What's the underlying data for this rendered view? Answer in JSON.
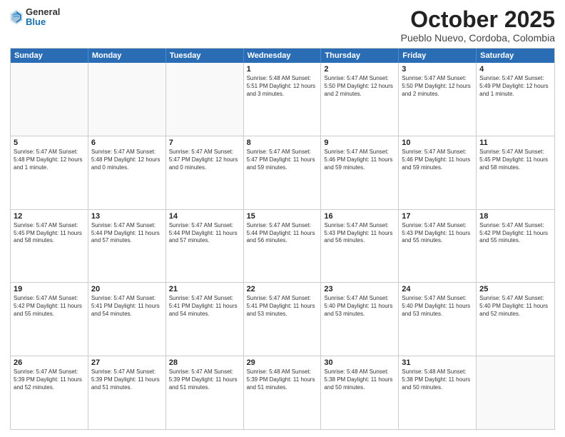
{
  "logo": {
    "general": "General",
    "blue": "Blue"
  },
  "title": "October 2025",
  "subtitle": "Pueblo Nuevo, Cordoba, Colombia",
  "days": [
    "Sunday",
    "Monday",
    "Tuesday",
    "Wednesday",
    "Thursday",
    "Friday",
    "Saturday"
  ],
  "weeks": [
    [
      {
        "day": "",
        "data": ""
      },
      {
        "day": "",
        "data": ""
      },
      {
        "day": "",
        "data": ""
      },
      {
        "day": "1",
        "data": "Sunrise: 5:48 AM\nSunset: 5:51 PM\nDaylight: 12 hours and 3 minutes."
      },
      {
        "day": "2",
        "data": "Sunrise: 5:47 AM\nSunset: 5:50 PM\nDaylight: 12 hours and 2 minutes."
      },
      {
        "day": "3",
        "data": "Sunrise: 5:47 AM\nSunset: 5:50 PM\nDaylight: 12 hours and 2 minutes."
      },
      {
        "day": "4",
        "data": "Sunrise: 5:47 AM\nSunset: 5:49 PM\nDaylight: 12 hours and 1 minute."
      }
    ],
    [
      {
        "day": "5",
        "data": "Sunrise: 5:47 AM\nSunset: 5:48 PM\nDaylight: 12 hours and 1 minute."
      },
      {
        "day": "6",
        "data": "Sunrise: 5:47 AM\nSunset: 5:48 PM\nDaylight: 12 hours and 0 minutes."
      },
      {
        "day": "7",
        "data": "Sunrise: 5:47 AM\nSunset: 5:47 PM\nDaylight: 12 hours and 0 minutes."
      },
      {
        "day": "8",
        "data": "Sunrise: 5:47 AM\nSunset: 5:47 PM\nDaylight: 11 hours and 59 minutes."
      },
      {
        "day": "9",
        "data": "Sunrise: 5:47 AM\nSunset: 5:46 PM\nDaylight: 11 hours and 59 minutes."
      },
      {
        "day": "10",
        "data": "Sunrise: 5:47 AM\nSunset: 5:46 PM\nDaylight: 11 hours and 59 minutes."
      },
      {
        "day": "11",
        "data": "Sunrise: 5:47 AM\nSunset: 5:45 PM\nDaylight: 11 hours and 58 minutes."
      }
    ],
    [
      {
        "day": "12",
        "data": "Sunrise: 5:47 AM\nSunset: 5:45 PM\nDaylight: 11 hours and 58 minutes."
      },
      {
        "day": "13",
        "data": "Sunrise: 5:47 AM\nSunset: 5:44 PM\nDaylight: 11 hours and 57 minutes."
      },
      {
        "day": "14",
        "data": "Sunrise: 5:47 AM\nSunset: 5:44 PM\nDaylight: 11 hours and 57 minutes."
      },
      {
        "day": "15",
        "data": "Sunrise: 5:47 AM\nSunset: 5:44 PM\nDaylight: 11 hours and 56 minutes."
      },
      {
        "day": "16",
        "data": "Sunrise: 5:47 AM\nSunset: 5:43 PM\nDaylight: 11 hours and 56 minutes."
      },
      {
        "day": "17",
        "data": "Sunrise: 5:47 AM\nSunset: 5:43 PM\nDaylight: 11 hours and 55 minutes."
      },
      {
        "day": "18",
        "data": "Sunrise: 5:47 AM\nSunset: 5:42 PM\nDaylight: 11 hours and 55 minutes."
      }
    ],
    [
      {
        "day": "19",
        "data": "Sunrise: 5:47 AM\nSunset: 5:42 PM\nDaylight: 11 hours and 55 minutes."
      },
      {
        "day": "20",
        "data": "Sunrise: 5:47 AM\nSunset: 5:41 PM\nDaylight: 11 hours and 54 minutes."
      },
      {
        "day": "21",
        "data": "Sunrise: 5:47 AM\nSunset: 5:41 PM\nDaylight: 11 hours and 54 minutes."
      },
      {
        "day": "22",
        "data": "Sunrise: 5:47 AM\nSunset: 5:41 PM\nDaylight: 11 hours and 53 minutes."
      },
      {
        "day": "23",
        "data": "Sunrise: 5:47 AM\nSunset: 5:40 PM\nDaylight: 11 hours and 53 minutes."
      },
      {
        "day": "24",
        "data": "Sunrise: 5:47 AM\nSunset: 5:40 PM\nDaylight: 11 hours and 53 minutes."
      },
      {
        "day": "25",
        "data": "Sunrise: 5:47 AM\nSunset: 5:40 PM\nDaylight: 11 hours and 52 minutes."
      }
    ],
    [
      {
        "day": "26",
        "data": "Sunrise: 5:47 AM\nSunset: 5:39 PM\nDaylight: 11 hours and 52 minutes."
      },
      {
        "day": "27",
        "data": "Sunrise: 5:47 AM\nSunset: 5:39 PM\nDaylight: 11 hours and 51 minutes."
      },
      {
        "day": "28",
        "data": "Sunrise: 5:47 AM\nSunset: 5:39 PM\nDaylight: 11 hours and 51 minutes."
      },
      {
        "day": "29",
        "data": "Sunrise: 5:48 AM\nSunset: 5:39 PM\nDaylight: 11 hours and 51 minutes."
      },
      {
        "day": "30",
        "data": "Sunrise: 5:48 AM\nSunset: 5:38 PM\nDaylight: 11 hours and 50 minutes."
      },
      {
        "day": "31",
        "data": "Sunrise: 5:48 AM\nSunset: 5:38 PM\nDaylight: 11 hours and 50 minutes."
      },
      {
        "day": "",
        "data": ""
      }
    ]
  ]
}
